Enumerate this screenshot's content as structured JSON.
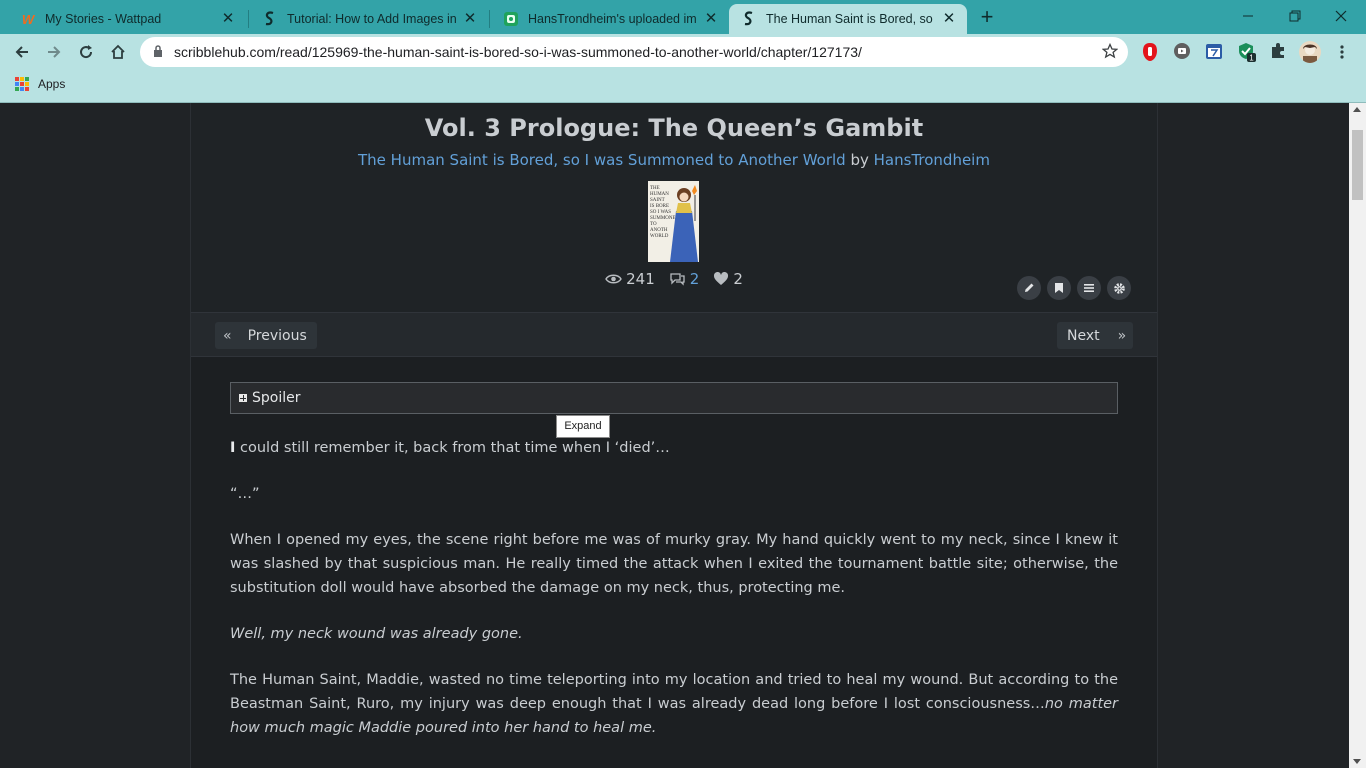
{
  "browser": {
    "tabs": [
      {
        "title": "My Stories - Wattpad",
        "favicon": "wattpad-icon",
        "active": false
      },
      {
        "title": "Tutorial: How to Add Images in Y",
        "favicon": "scribblehub-icon",
        "active": false
      },
      {
        "title": "HansTrondheim's uploaded imag",
        "favicon": "imgbox-icon",
        "active": false
      },
      {
        "title": "The Human Saint is Bored, so I w",
        "favicon": "scribblehub-icon",
        "active": true
      }
    ],
    "url": "scribblehub.com/read/125969-the-human-saint-is-bored-so-i-was-summoned-to-another-world/chapter/127173/",
    "bookmarks": {
      "apps_label": "Apps"
    },
    "extension_badge": "1",
    "colors": {
      "tabstrip": "#33a3a8",
      "toolbar": "#b8e2e2"
    }
  },
  "chapter": {
    "title": "Vol. 3 Prologue: The Queen’s Gambit",
    "series_title": "The Human Saint is Bored, so I was Summoned to Another World",
    "by": "by",
    "author": "HansTrondheim",
    "stats": {
      "views": "241",
      "comments": "2",
      "favorites": "2"
    },
    "cover_text": [
      "THE",
      "HUMAN",
      "SAINT",
      "IS BORE",
      "SO I WAS",
      "SUMMONE",
      "TO",
      "ANOTH",
      "WORLD"
    ],
    "nav": {
      "previous": "Previous",
      "next": "Next",
      "prev_arrow": "«",
      "next_arrow": "»"
    },
    "spoiler_label": "Spoiler",
    "tooltip": "Expand",
    "paragraphs": {
      "p1_first_letter": "I",
      "p1_rest": " could still remember it, back from that time when I ‘died’…",
      "p2": "“…”",
      "p3": "When I opened my eyes, the scene right before me was of murky gray. My hand quickly went to my neck, since I knew it was slashed by that suspicious man. He really timed the attack when I exited the tournament battle site; otherwise, the substitution doll would have absorbed the damage on my neck, thus, protecting me.",
      "p4": "Well, my neck wound was already gone.",
      "p5_normal": "The Human Saint, Maddie, wasted no time teleporting into my location and tried to heal my wound. But according to the Beastman Saint, Ruro, my injury was deep enough that I was already dead long before I lost consciousness…",
      "p5_italic": "no matter how much magic Maddie poured into her hand to heal me."
    }
  }
}
